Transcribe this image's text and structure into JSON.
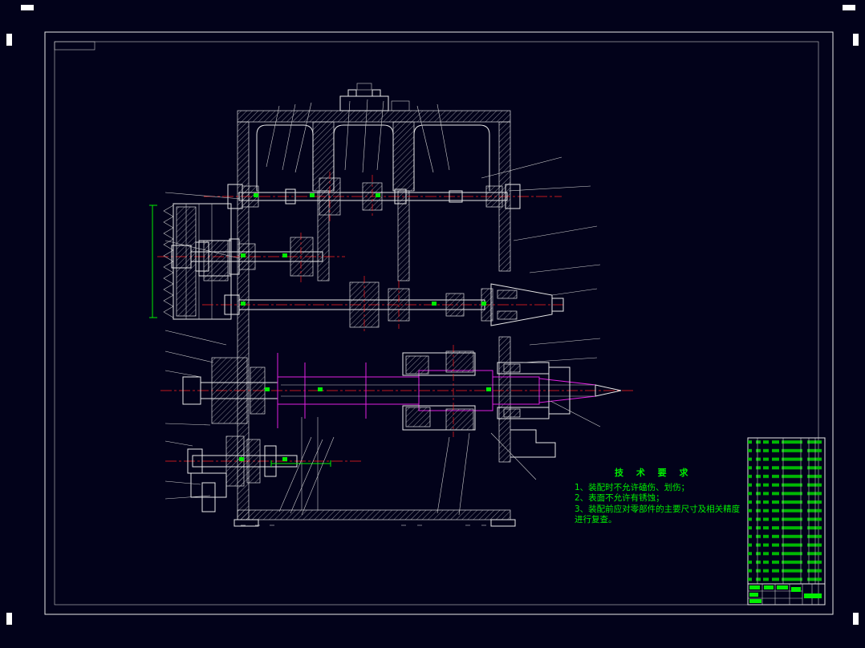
{
  "app": {
    "background_color": "#02021a"
  },
  "palette": {
    "frame_white": "#ffffff",
    "drawing_outline": "#e8e8e8",
    "centerline_red": "#ff2020",
    "annotation_green": "#00ee00",
    "shaft_magenta": "#e020e0"
  },
  "technical_requirements": {
    "title": "技 术 要 求",
    "items": [
      "1、装配时不允许磕伤、划伤；",
      "2、表面不允许有锈蚀；",
      "3、装配前应对零部件的主要尺寸及相关精度",
      "进行复查。"
    ]
  },
  "parts_table": {
    "rows": 17,
    "columns": 6
  }
}
